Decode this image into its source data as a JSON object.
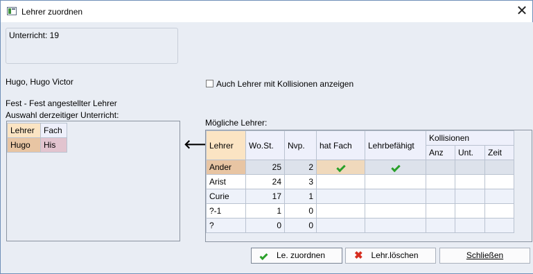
{
  "window": {
    "title": "Lehrer zuordnen"
  },
  "unterricht": "Unterricht: 19",
  "teacher_name": "Hugo, Hugo Victor",
  "teacher_type": "Fest - Fest angestellter Lehrer",
  "selection_label": "Auswahl derzeitiger Unterricht:",
  "current": {
    "headers": [
      "Lehrer",
      "Fach"
    ],
    "row": [
      "Hugo",
      "His"
    ]
  },
  "collision_checkbox": {
    "label": "Auch Lehrer mit Kollisionen anzeigen",
    "checked": false
  },
  "possible_label": "Mögliche Lehrer:",
  "lehrer_table": {
    "headers": {
      "lehrer": "Lehrer",
      "wost": "Wo.St.",
      "nvp": "Nvp.",
      "hat_fach": "hat Fach",
      "lehrbef": "Lehrbefähigt",
      "kollisionen": "Kollisionen",
      "anz": "Anz",
      "unt": "Unt.",
      "zeit": "Zeit"
    },
    "rows": [
      {
        "name": "Ander",
        "wost": "25",
        "nvp": "2",
        "hat_fach": true,
        "lehrbef": true
      },
      {
        "name": "Arist",
        "wost": "24",
        "nvp": "3",
        "hat_fach": false,
        "lehrbef": false
      },
      {
        "name": "Curie",
        "wost": "17",
        "nvp": "1",
        "hat_fach": false,
        "lehrbef": false
      },
      {
        "name": "?-1",
        "wost": "1",
        "nvp": "0",
        "hat_fach": false,
        "lehrbef": false
      },
      {
        "name": "?",
        "wost": "0",
        "nvp": "0",
        "hat_fach": false,
        "lehrbef": false
      }
    ]
  },
  "buttons": {
    "assign": "Le. zuordnen",
    "delete": "Lehr.löschen",
    "close": "Schließen"
  }
}
